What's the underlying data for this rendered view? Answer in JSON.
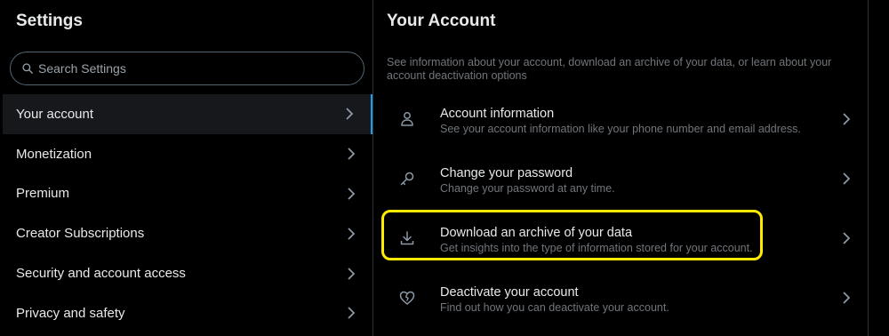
{
  "left": {
    "title": "Settings",
    "search": {
      "placeholder": "Search Settings",
      "icon": "search-icon"
    },
    "items": [
      {
        "label": "Your account",
        "active": true
      },
      {
        "label": "Monetization"
      },
      {
        "label": "Premium"
      },
      {
        "label": "Creator Subscriptions"
      },
      {
        "label": "Security and account access"
      },
      {
        "label": "Privacy and safety"
      }
    ]
  },
  "right": {
    "title": "Your Account",
    "description": "See information about your account, download an archive of your data, or learn about your account deactivation options",
    "options": [
      {
        "title": "Account information",
        "subtitle": "See your account information like your phone number and email address.",
        "icon": "person-icon"
      },
      {
        "title": "Change your password",
        "subtitle": "Change your password at any time.",
        "icon": "key-icon"
      },
      {
        "title": "Download an archive of your data",
        "subtitle": "Get insights into the type of information stored for your account.",
        "icon": "download-icon",
        "highlighted": true
      },
      {
        "title": "Deactivate your account",
        "subtitle": "Find out how you can deactivate your account.",
        "icon": "broken-heart-icon"
      }
    ]
  },
  "colors": {
    "background": "#000000",
    "text_primary": "#e7e9ea",
    "text_secondary": "#71767b",
    "active_indicator": "#1d9bf0",
    "highlight": "#ffeb00"
  }
}
